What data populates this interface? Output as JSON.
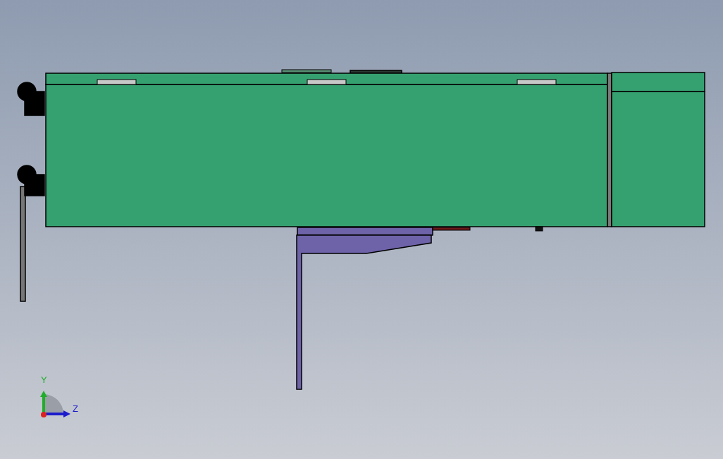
{
  "viewport": {
    "triad": {
      "axes": [
        {
          "kind": "vertical",
          "label": "Y",
          "color": "#1fae2a"
        },
        {
          "kind": "horizontal",
          "label": "Z",
          "color": "#1c1ccc"
        }
      ]
    }
  }
}
